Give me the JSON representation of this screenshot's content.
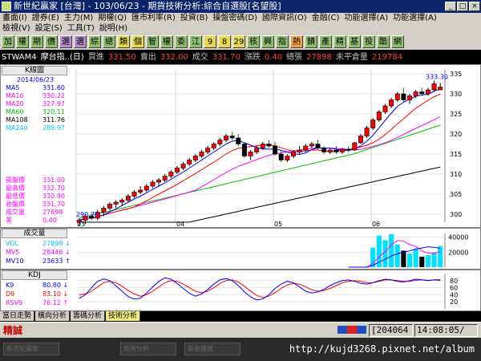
{
  "window": {
    "title": "新世紀贏家 [台灣] - 103/06/23 - 期貨技術分析:綜合自選股[名望股]"
  },
  "menu1": {
    "left": [
      "畫面(I)",
      "證券(E)",
      "主力(M)",
      "期權(Q)",
      "匯市利率(R)",
      "投資(B)",
      "操盤密碼(D)",
      "國際資訊(O)",
      "金融(C)"
    ],
    "right": [
      "功能選擇(A)",
      "功能選擇(A)"
    ]
  },
  "menu2": [
    "檢視(V)",
    "設定(S)",
    "工具(T)",
    "說明(H)"
  ],
  "toolbar": [
    "加",
    "權",
    "期",
    "價",
    "選",
    "選",
    "綜",
    "總",
    "類",
    "個",
    "智",
    "權",
    "委",
    "江",
    "9",
    "8",
    "29",
    "核",
    "興",
    "指",
    "熱",
    "饋",
    "產",
    "精",
    "基",
    "投",
    "酷",
    "網"
  ],
  "quote": {
    "symbol": "STWAM4",
    "name": "摩台指..(日)",
    "bid_label": "買進",
    "bid": "331.50",
    "ask_label": "賣出",
    "ask": "332.00",
    "last_label": "成交",
    "last": "331.70",
    "chg_label": "漲跌",
    "chg": "0.40",
    "vol_label": "總張",
    "vol": "27898",
    "oi_label": "未平倉量",
    "oi": "219784"
  },
  "kline": {
    "header": "K線圖",
    "date": "2014/06/23",
    "ma": [
      {
        "label": "MA5",
        "value": "331.60",
        "color": "#0000ff"
      },
      {
        "label": "MA10",
        "value": "330.22",
        "color": "#ff00ff"
      },
      {
        "label": "MA20",
        "value": "327.97",
        "color": "#ff00ff"
      },
      {
        "label": "MA60",
        "value": "320.11",
        "color": "#00c000"
      },
      {
        "label": "MA108",
        "value": "311.76",
        "color": "#000000"
      },
      {
        "label": "MA240",
        "value": "289.97",
        "color": "#00c0ff"
      }
    ],
    "ohlc": [
      {
        "label": "開盤價",
        "value": "331.00"
      },
      {
        "label": "最高價",
        "value": "332.70"
      },
      {
        "label": "最低價",
        "value": "330.90"
      },
      {
        "label": "收盤價",
        "value": "331.70"
      },
      {
        "label": "成交量",
        "value": "27898"
      },
      {
        "label": "差",
        "value": "0.40"
      }
    ],
    "high_marker": "333.30",
    "low_marker": "290.70",
    "months": [
      "03",
      "04",
      "05",
      "06"
    ],
    "yaxis": [
      "335",
      "330",
      "325",
      "320",
      "315",
      "310",
      "305",
      "300"
    ]
  },
  "volume": {
    "header": "成交量",
    "rows": [
      {
        "label": "VOL",
        "value": "27898",
        "arrow": "↓",
        "color": "#00c0ff"
      },
      {
        "label": "MV5",
        "value": "28446",
        "arrow": "↓",
        "color": "#ff00ff"
      },
      {
        "label": "MV10",
        "value": "23633",
        "arrow": "↑",
        "color": "#0000ff"
      }
    ],
    "yaxis": [
      "40000",
      "20000"
    ]
  },
  "kdj": {
    "header": "KDJ",
    "rows": [
      {
        "label": "K9",
        "value": "80.80",
        "arrow": "↓",
        "color": "#0000ff"
      },
      {
        "label": "D9",
        "value": "83.10",
        "arrow": "↓",
        "color": "#ff0000"
      },
      {
        "label": "RSV9",
        "value": "76.12",
        "arrow": "↑",
        "color": "#ff00ff"
      }
    ],
    "yaxis": [
      "80",
      "60",
      "40",
      "20"
    ]
  },
  "tabs": [
    "當日走勢",
    "橫向分析",
    "籌碼分析",
    "技術分析"
  ],
  "status": {
    "left": "精誠",
    "code": "[204064",
    "time": "14:08:05/"
  },
  "taskbar": [
    "新世紀贏家",
    "技術分析",
    "影音播放"
  ],
  "watermark": "http://kujd3268.pixnet.net/album",
  "chart_data": {
    "type": "candlestick",
    "title": "STWAM4 摩台指..(日) K線圖",
    "months": [
      "03",
      "04",
      "05",
      "06"
    ],
    "ylim": [
      298,
      336
    ],
    "candles": [
      [
        298,
        299,
        297,
        298.5
      ],
      [
        298.5,
        300,
        297.5,
        299.5
      ],
      [
        299.5,
        300.2,
        298.5,
        299
      ],
      [
        299,
        301,
        298.5,
        300.5
      ],
      [
        300.5,
        302,
        299.5,
        301.5
      ],
      [
        301.5,
        303,
        301,
        302.5
      ],
      [
        302.5,
        303.5,
        301.5,
        303
      ],
      [
        303,
        304,
        302,
        303.5
      ],
      [
        303.5,
        305,
        303,
        304.5
      ],
      [
        304.5,
        306,
        304,
        305.5
      ],
      [
        305.5,
        307,
        305,
        306
      ],
      [
        306,
        307.5,
        305.5,
        307
      ],
      [
        307,
        308.5,
        306.5,
        308
      ],
      [
        308,
        309,
        307,
        308.5
      ],
      [
        308.5,
        310,
        308,
        309.5
      ],
      [
        309.5,
        311,
        309,
        310.5
      ],
      [
        310.5,
        312,
        310,
        311.5
      ],
      [
        311.5,
        313,
        311,
        312.5
      ],
      [
        312.5,
        314,
        312,
        313.5
      ],
      [
        313.5,
        315,
        313,
        314.5
      ],
      [
        314.5,
        316,
        314,
        315.5
      ],
      [
        315.5,
        317,
        315,
        316.5
      ],
      [
        316.5,
        318,
        316,
        317.5
      ],
      [
        317.5,
        319,
        317,
        318.5
      ],
      [
        318.5,
        320,
        318,
        319.5
      ],
      [
        319.5,
        320.5,
        318.5,
        319
      ],
      [
        319,
        320,
        317,
        317.5
      ],
      [
        317.5,
        318,
        314,
        314.5
      ],
      [
        314.5,
        316,
        313.5,
        315.5
      ],
      [
        315.5,
        317,
        315,
        316.5
      ],
      [
        316.5,
        318,
        316,
        317.5
      ],
      [
        317.5,
        318.5,
        316.5,
        317
      ],
      [
        317,
        318,
        314.5,
        315
      ],
      [
        315,
        316,
        313,
        313.5
      ],
      [
        313.5,
        315,
        313,
        314.5
      ],
      [
        314.5,
        316,
        314,
        315.5
      ],
      [
        315.5,
        317,
        315,
        316
      ],
      [
        316,
        317.5,
        315.5,
        317
      ],
      [
        317,
        318,
        316.5,
        317.5
      ],
      [
        317.5,
        318.5,
        316,
        316.5
      ],
      [
        316.5,
        317,
        315,
        315.5
      ],
      [
        315.5,
        316.5,
        315,
        316
      ],
      [
        316,
        317,
        315,
        315.5
      ],
      [
        315.5,
        316.5,
        315,
        316.2
      ],
      [
        316.2,
        317,
        315.5,
        316
      ],
      [
        316,
        318,
        315.8,
        317.8
      ],
      [
        317.8,
        320,
        317.5,
        319.5
      ],
      [
        319.5,
        322,
        319,
        321.5
      ],
      [
        321.5,
        324,
        321,
        323.5
      ],
      [
        323.5,
        326,
        323,
        325.5
      ],
      [
        325.5,
        327.5,
        325,
        327
      ],
      [
        327,
        329,
        326.5,
        328.5
      ],
      [
        328.5,
        330.5,
        328,
        330
      ],
      [
        330,
        331.5,
        328,
        328.5
      ],
      [
        328.5,
        330,
        327.5,
        329.5
      ],
      [
        329.5,
        331,
        329,
        330.5
      ],
      [
        330.5,
        331.5,
        329.5,
        330
      ],
      [
        330,
        331.5,
        329.5,
        331
      ],
      [
        331,
        333.3,
        330.5,
        332.5
      ],
      [
        331,
        332.7,
        330.9,
        331.7
      ]
    ],
    "ma_series": [
      {
        "name": "MA5",
        "end_value": 331.6
      },
      {
        "name": "MA10",
        "end_value": 330.22
      },
      {
        "name": "MA20",
        "end_value": 327.97
      },
      {
        "name": "MA60",
        "end_value": 320.11
      },
      {
        "name": "MA108",
        "end_value": 311.76
      },
      {
        "name": "MA240",
        "end_value": 289.97
      }
    ],
    "volume": {
      "ylim": [
        0,
        45000
      ],
      "values": [
        0,
        0,
        0,
        0,
        0,
        0,
        0,
        0,
        0,
        0,
        0,
        0,
        0,
        0,
        0,
        0,
        0,
        0,
        0,
        0,
        0,
        0,
        0,
        0,
        0,
        0,
        0,
        0,
        0,
        0,
        0,
        0,
        0,
        0,
        0,
        0,
        0,
        0,
        0,
        0,
        0,
        0,
        0,
        0,
        0,
        0,
        0,
        0,
        26000,
        42000,
        36000,
        44000,
        30000,
        22000,
        18000,
        24000,
        14000,
        16000,
        20000,
        27898
      ]
    },
    "kdj": {
      "ylim": [
        0,
        100
      ],
      "K": [
        30,
        40,
        60,
        78,
        85,
        80,
        65,
        50,
        35,
        28,
        30,
        45,
        62,
        78,
        88,
        84,
        72,
        58,
        44,
        36,
        42,
        55,
        70,
        82,
        86,
        80,
        66,
        48,
        34,
        25,
        28,
        40,
        58,
        70,
        78,
        74,
        62,
        50,
        45,
        48,
        55,
        66,
        74,
        80,
        82,
        78,
        72,
        70,
        74,
        80,
        84,
        82,
        78,
        76,
        80,
        84,
        82,
        80,
        82,
        80.8
      ],
      "D": [
        40,
        42,
        50,
        62,
        74,
        78,
        74,
        64,
        52,
        42,
        36,
        40,
        50,
        62,
        74,
        80,
        78,
        70,
        60,
        50,
        46,
        50,
        60,
        72,
        80,
        82,
        76,
        64,
        50,
        38,
        32,
        36,
        46,
        58,
        68,
        72,
        70,
        62,
        54,
        50,
        52,
        58,
        66,
        74,
        78,
        80,
        78,
        74,
        74,
        78,
        82,
        82,
        80,
        78,
        78,
        81,
        82,
        81,
        82,
        83.1
      ]
    }
  }
}
